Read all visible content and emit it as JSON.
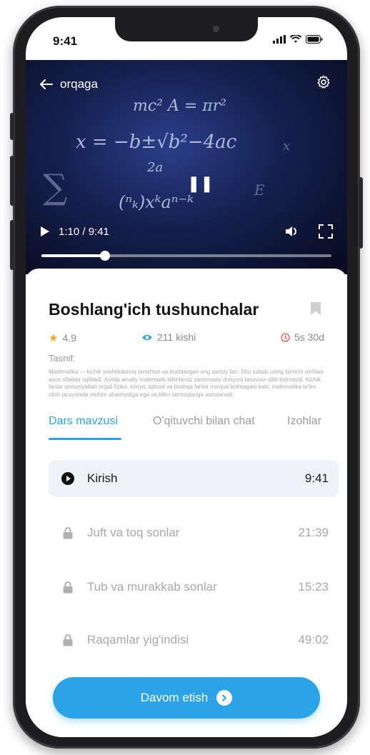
{
  "status_bar": {
    "time": "9:41"
  },
  "video": {
    "back_label": "orqaga",
    "time_readout": "1:10 / 9:41",
    "progress": 0.22
  },
  "lesson": {
    "title": "Boshlang'ich tushunchalar",
    "rating": "4.9",
    "viewers": "211 kishi",
    "duration": "5s 30d",
    "description_label": "Tasnif:",
    "description": "Matematika — kichik yoshlikdanoq tanishish va boshlangan eng asosiy fan. Shu sabab uning birinchi sinfdan asos sifatida oqitiladi. Aslida amaliy matematik bilimlarsiz zamonaviy dunyoni tasavvur qilib bolmaydi. Kichik fanlar qonuniyatlari orqali fizika, kimyo, iqtisod va boshqa fanlar mavjud bolmagani kabi, matematika ta'lim olish jarayonida muhim ahamiyatga ega va bilim tarmoqlariga asoslanadi."
  },
  "tabs": [
    {
      "label": "Dars mavzusi",
      "active": true
    },
    {
      "label": "O'qituvchi bilan chat",
      "active": false
    },
    {
      "label": "Izohlar",
      "active": false
    }
  ],
  "lessons": [
    {
      "title": "Kirish",
      "duration": "9:41",
      "state": "playing",
      "icon": "play-circle-icon"
    },
    {
      "title": "Juft va toq sonlar",
      "duration": "21:39",
      "state": "locked",
      "icon": "lock-icon"
    },
    {
      "title": "Tub va murakkab sonlar",
      "duration": "15:23",
      "state": "locked",
      "icon": "lock-icon"
    },
    {
      "title": "Raqamlar yig'indisi",
      "duration": "49:02",
      "state": "locked",
      "icon": "lock-icon"
    }
  ],
  "cta": {
    "label": "Davom etish",
    "icon": "arrow-right-circle-icon"
  },
  "colors": {
    "accent": "#2ba3e6",
    "star": "#f5a623",
    "eye": "#2ba3e6",
    "clock": "#ef5350"
  }
}
